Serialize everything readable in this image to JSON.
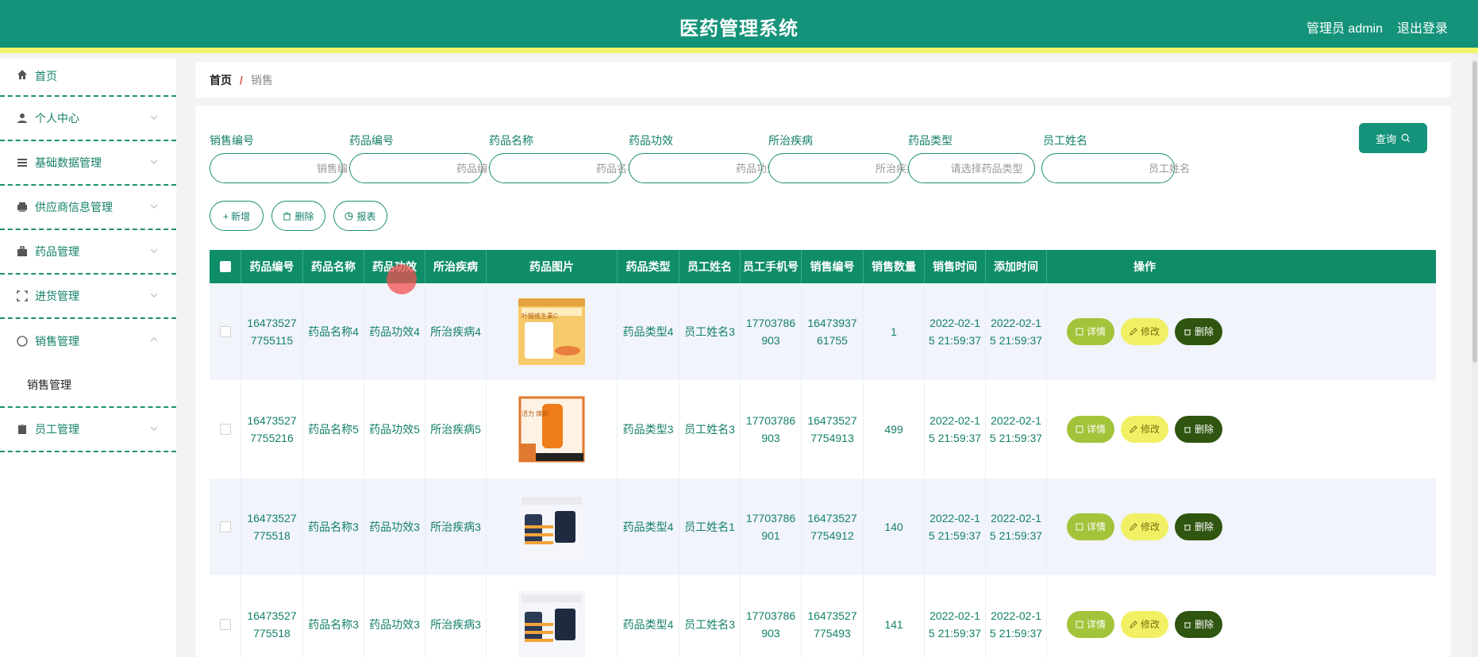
{
  "header": {
    "title": "医药管理系统",
    "user": "管理员 admin",
    "logout": "退出登录"
  },
  "sidebar": {
    "items": [
      {
        "label": "首页",
        "icon": "home-icon"
      },
      {
        "label": "个人中心",
        "icon": "user-icon"
      },
      {
        "label": "基础数据管理",
        "icon": "list-icon"
      },
      {
        "label": "供应商信息管理",
        "icon": "printer-icon"
      },
      {
        "label": "药品管理",
        "icon": "briefcase-icon"
      },
      {
        "label": "进货管理",
        "icon": "frame-icon"
      },
      {
        "label": "销售管理",
        "icon": "compass-icon"
      },
      {
        "label": "员工管理",
        "icon": "clipboard-icon"
      }
    ],
    "submenu": {
      "label": "销售管理"
    }
  },
  "breadcrumb": {
    "home": "首页",
    "separator": "/",
    "current": "销售"
  },
  "search": {
    "fields": [
      {
        "label": "销售编号",
        "placeholder": "销售编号"
      },
      {
        "label": "药品编号",
        "placeholder": "药品编号"
      },
      {
        "label": "药品名称",
        "placeholder": "药品名称"
      },
      {
        "label": "药品功效",
        "placeholder": "药品功效"
      },
      {
        "label": "所治疾病",
        "placeholder": "所治疾病"
      },
      {
        "label": "药品类型",
        "placeholder": "请选择药品类型"
      },
      {
        "label": "员工姓名",
        "placeholder": "员工姓名"
      }
    ],
    "query_label": "查询"
  },
  "actions": {
    "add": "+ 新增",
    "delete": "删除",
    "report": "报表"
  },
  "table": {
    "headers": [
      "药品编号",
      "药品名称",
      "药品功效",
      "所治疾病",
      "药品图片",
      "药品类型",
      "员工姓名",
      "员工手机号",
      "销售编号",
      "销售数量",
      "销售时间",
      "添加时间",
      "操作"
    ],
    "rows": [
      {
        "drug_no_1": "16473527",
        "drug_no_2": "7755115",
        "name": "药品名称4",
        "effect": "药品功效4",
        "disease": "所治疾病4",
        "type": "药品类型4",
        "staff": "员工姓名3",
        "phone_1": "17703786",
        "phone_2": "903",
        "sale_no_1": "16473937",
        "sale_no_2": "61755",
        "qty": "1",
        "sale_time_1": "2022-02-1",
        "sale_time_2": "5 21:59:37",
        "add_time_1": "2022-02-1",
        "add_time_2": "5 21:59:37",
        "img_label": "叶酸维生素C"
      },
      {
        "drug_no_1": "16473527",
        "drug_no_2": "7755216",
        "name": "药品名称5",
        "effect": "药品功效5",
        "disease": "所治疾病5",
        "type": "药品类型3",
        "staff": "员工姓名3",
        "phone_1": "17703786",
        "phone_2": "903",
        "sale_no_1": "16473527",
        "sale_no_2": "7754913",
        "qty": "499",
        "sale_time_1": "2022-02-1",
        "sale_time_2": "5 21:59:37",
        "add_time_1": "2022-02-1",
        "add_time_2": "5 21:59:37",
        "img_label": "活力 焕颜"
      },
      {
        "drug_no_1": "16473527",
        "drug_no_2": "775518",
        "name": "药品名称3",
        "effect": "药品功效3",
        "disease": "所治疾病3",
        "type": "药品类型4",
        "staff": "员工姓名1",
        "phone_1": "17703786",
        "phone_2": "901",
        "sale_no_1": "16473527",
        "sale_no_2": "7754912",
        "qty": "140",
        "sale_time_1": "2022-02-1",
        "sale_time_2": "5 21:59:37",
        "add_time_1": "2022-02-1",
        "add_time_2": "5 21:59:37",
        "img_label": ""
      },
      {
        "drug_no_1": "16473527",
        "drug_no_2": "775518",
        "name": "药品名称3",
        "effect": "药品功效3",
        "disease": "所治疾病3",
        "type": "药品类型4",
        "staff": "员工姓名3",
        "phone_1": "17703786",
        "phone_2": "903",
        "sale_no_1": "16473527",
        "sale_no_2": "775493",
        "qty": "141",
        "sale_time_1": "2022-02-1",
        "sale_time_2": "5 21:59:37",
        "add_time_1": "2022-02-1",
        "add_time_2": "5 21:59:37",
        "img_label": ""
      }
    ],
    "ops": {
      "detail": "详情",
      "edit": "修改",
      "delete": "删除"
    }
  },
  "colors": {
    "primary": "#14937a",
    "header_stripe": "#f0f56a",
    "detail": "#a3c33a",
    "edit": "#f1f064",
    "delete": "#2f5510"
  }
}
